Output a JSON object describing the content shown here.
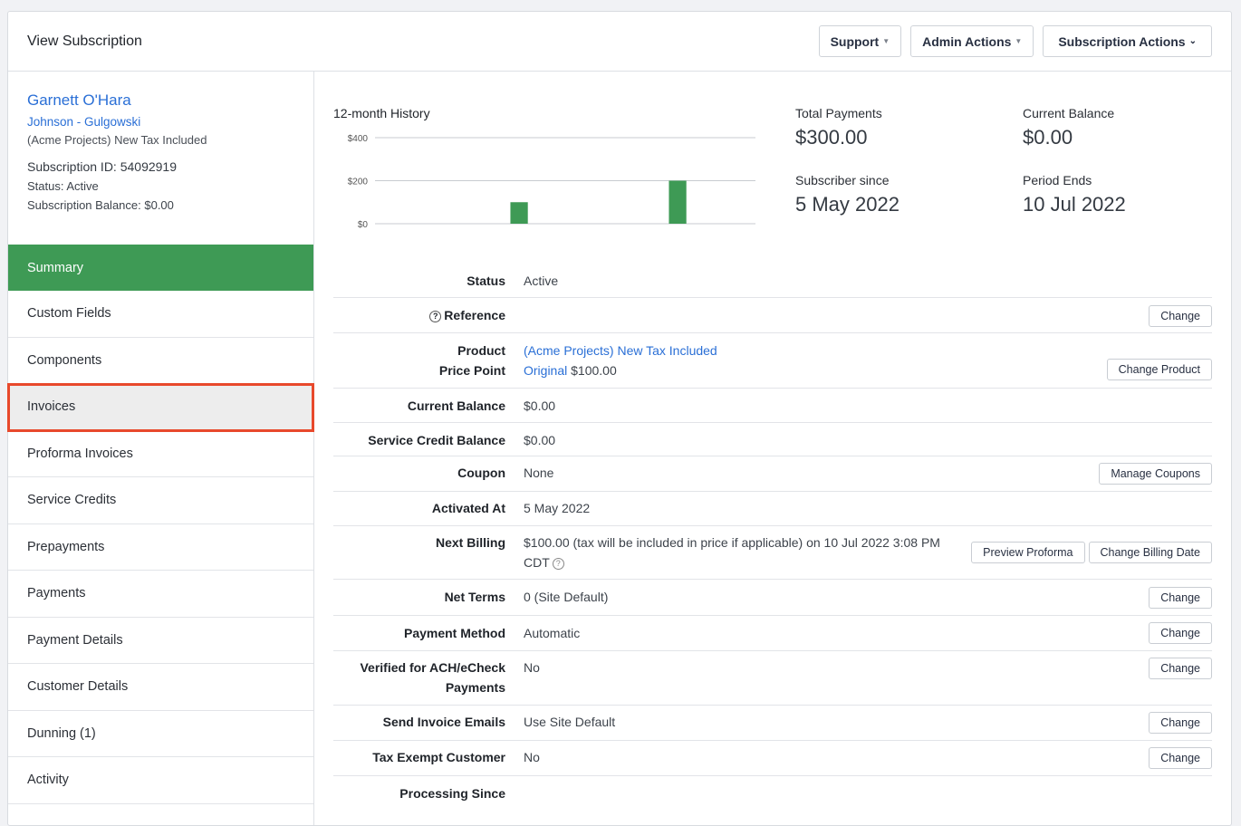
{
  "header": {
    "title": "View Subscription",
    "buttons": {
      "support": "Support",
      "admin": "Admin Actions",
      "subscription": "Subscription Actions"
    }
  },
  "customer": {
    "name": "Garnett O'Hara",
    "organization": "Johnson - Gulgowski",
    "product": "(Acme Projects) New Tax Included",
    "subscription_id": "Subscription ID: 54092919",
    "status": "Status: Active",
    "balance": "Subscription Balance: $0.00"
  },
  "nav": {
    "items": [
      "Summary",
      "Custom Fields",
      "Components",
      "Invoices",
      "Proforma Invoices",
      "Service Credits",
      "Prepayments",
      "Payments",
      "Payment Details",
      "Customer Details",
      "Dunning (1)",
      "Activity"
    ],
    "active": "Summary",
    "highlighted": "Invoices"
  },
  "history": {
    "title": "12-month History",
    "chart_data": {
      "type": "bar",
      "y_ticks": [
        "$400",
        "$200",
        "$0"
      ],
      "ylim": [
        0,
        400
      ],
      "values": [
        0,
        0,
        0,
        0,
        100,
        0,
        0,
        0,
        0,
        200,
        0,
        0
      ],
      "bar_color": "#3e9a55"
    }
  },
  "stats": {
    "total_payments_label": "Total Payments",
    "total_payments": "$300.00",
    "current_balance_label": "Current Balance",
    "current_balance": "$0.00",
    "subscriber_since_label": "Subscriber since",
    "subscriber_since": "5 May 2022",
    "period_ends_label": "Period Ends",
    "period_ends": "10 Jul 2022"
  },
  "details": {
    "status_label": "Status",
    "status": "Active",
    "reference_label": "Reference",
    "change": "Change",
    "product_label": "Product",
    "product": "(Acme Projects) New Tax Included",
    "price_point_label": "Price Point",
    "price_point": "Original",
    "price": "$100.00",
    "change_product": "Change Product",
    "current_balance_label": "Current Balance",
    "current_balance": "$0.00",
    "service_credit_label": "Service Credit Balance",
    "service_credit": "$0.00",
    "coupon_label": "Coupon",
    "coupon": "None",
    "manage_coupons": "Manage Coupons",
    "activated_label": "Activated At",
    "activated": "5 May 2022",
    "next_billing_label": "Next Billing",
    "next_billing_1": "$100.00 (tax will be included in price if applicable) on 10 Jul 2022 3:08 PM",
    "next_billing_2": "CDT",
    "preview_proforma": "Preview Proforma",
    "change_billing_date": "Change Billing Date",
    "net_terms_label": "Net Terms",
    "net_terms": "0 (Site Default)",
    "payment_method_label": "Payment Method",
    "payment_method": "Automatic",
    "ach_label_1": "Verified for ACH/eCheck",
    "ach_label_2": "Payments",
    "ach": "No",
    "send_invoice_label": "Send Invoice Emails",
    "send_invoice": "Use Site Default",
    "tax_exempt_label": "Tax Exempt Customer",
    "tax_exempt": "No",
    "processing_label": "Processing Since"
  }
}
